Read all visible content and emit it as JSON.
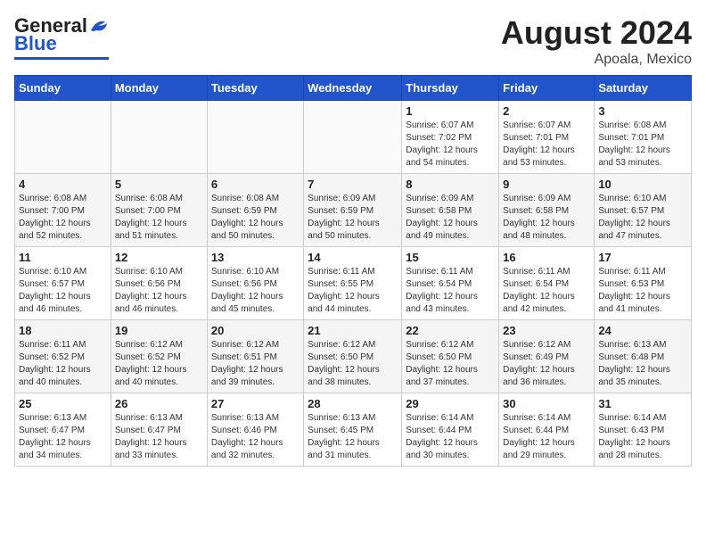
{
  "logo": {
    "general": "General",
    "blue": "Blue"
  },
  "title": "August 2024",
  "subtitle": "Apoala, Mexico",
  "weekdays": [
    "Sunday",
    "Monday",
    "Tuesday",
    "Wednesday",
    "Thursday",
    "Friday",
    "Saturday"
  ],
  "weeks": [
    [
      {
        "day": "",
        "detail": ""
      },
      {
        "day": "",
        "detail": ""
      },
      {
        "day": "",
        "detail": ""
      },
      {
        "day": "",
        "detail": ""
      },
      {
        "day": "1",
        "detail": "Sunrise: 6:07 AM\nSunset: 7:02 PM\nDaylight: 12 hours\nand 54 minutes."
      },
      {
        "day": "2",
        "detail": "Sunrise: 6:07 AM\nSunset: 7:01 PM\nDaylight: 12 hours\nand 53 minutes."
      },
      {
        "day": "3",
        "detail": "Sunrise: 6:08 AM\nSunset: 7:01 PM\nDaylight: 12 hours\nand 53 minutes."
      }
    ],
    [
      {
        "day": "4",
        "detail": "Sunrise: 6:08 AM\nSunset: 7:00 PM\nDaylight: 12 hours\nand 52 minutes."
      },
      {
        "day": "5",
        "detail": "Sunrise: 6:08 AM\nSunset: 7:00 PM\nDaylight: 12 hours\nand 51 minutes."
      },
      {
        "day": "6",
        "detail": "Sunrise: 6:08 AM\nSunset: 6:59 PM\nDaylight: 12 hours\nand 50 minutes."
      },
      {
        "day": "7",
        "detail": "Sunrise: 6:09 AM\nSunset: 6:59 PM\nDaylight: 12 hours\nand 50 minutes."
      },
      {
        "day": "8",
        "detail": "Sunrise: 6:09 AM\nSunset: 6:58 PM\nDaylight: 12 hours\nand 49 minutes."
      },
      {
        "day": "9",
        "detail": "Sunrise: 6:09 AM\nSunset: 6:58 PM\nDaylight: 12 hours\nand 48 minutes."
      },
      {
        "day": "10",
        "detail": "Sunrise: 6:10 AM\nSunset: 6:57 PM\nDaylight: 12 hours\nand 47 minutes."
      }
    ],
    [
      {
        "day": "11",
        "detail": "Sunrise: 6:10 AM\nSunset: 6:57 PM\nDaylight: 12 hours\nand 46 minutes."
      },
      {
        "day": "12",
        "detail": "Sunrise: 6:10 AM\nSunset: 6:56 PM\nDaylight: 12 hours\nand 46 minutes."
      },
      {
        "day": "13",
        "detail": "Sunrise: 6:10 AM\nSunset: 6:56 PM\nDaylight: 12 hours\nand 45 minutes."
      },
      {
        "day": "14",
        "detail": "Sunrise: 6:11 AM\nSunset: 6:55 PM\nDaylight: 12 hours\nand 44 minutes."
      },
      {
        "day": "15",
        "detail": "Sunrise: 6:11 AM\nSunset: 6:54 PM\nDaylight: 12 hours\nand 43 minutes."
      },
      {
        "day": "16",
        "detail": "Sunrise: 6:11 AM\nSunset: 6:54 PM\nDaylight: 12 hours\nand 42 minutes."
      },
      {
        "day": "17",
        "detail": "Sunrise: 6:11 AM\nSunset: 6:53 PM\nDaylight: 12 hours\nand 41 minutes."
      }
    ],
    [
      {
        "day": "18",
        "detail": "Sunrise: 6:11 AM\nSunset: 6:52 PM\nDaylight: 12 hours\nand 40 minutes."
      },
      {
        "day": "19",
        "detail": "Sunrise: 6:12 AM\nSunset: 6:52 PM\nDaylight: 12 hours\nand 40 minutes."
      },
      {
        "day": "20",
        "detail": "Sunrise: 6:12 AM\nSunset: 6:51 PM\nDaylight: 12 hours\nand 39 minutes."
      },
      {
        "day": "21",
        "detail": "Sunrise: 6:12 AM\nSunset: 6:50 PM\nDaylight: 12 hours\nand 38 minutes."
      },
      {
        "day": "22",
        "detail": "Sunrise: 6:12 AM\nSunset: 6:50 PM\nDaylight: 12 hours\nand 37 minutes."
      },
      {
        "day": "23",
        "detail": "Sunrise: 6:12 AM\nSunset: 6:49 PM\nDaylight: 12 hours\nand 36 minutes."
      },
      {
        "day": "24",
        "detail": "Sunrise: 6:13 AM\nSunset: 6:48 PM\nDaylight: 12 hours\nand 35 minutes."
      }
    ],
    [
      {
        "day": "25",
        "detail": "Sunrise: 6:13 AM\nSunset: 6:47 PM\nDaylight: 12 hours\nand 34 minutes."
      },
      {
        "day": "26",
        "detail": "Sunrise: 6:13 AM\nSunset: 6:47 PM\nDaylight: 12 hours\nand 33 minutes."
      },
      {
        "day": "27",
        "detail": "Sunrise: 6:13 AM\nSunset: 6:46 PM\nDaylight: 12 hours\nand 32 minutes."
      },
      {
        "day": "28",
        "detail": "Sunrise: 6:13 AM\nSunset: 6:45 PM\nDaylight: 12 hours\nand 31 minutes."
      },
      {
        "day": "29",
        "detail": "Sunrise: 6:14 AM\nSunset: 6:44 PM\nDaylight: 12 hours\nand 30 minutes."
      },
      {
        "day": "30",
        "detail": "Sunrise: 6:14 AM\nSunset: 6:44 PM\nDaylight: 12 hours\nand 29 minutes."
      },
      {
        "day": "31",
        "detail": "Sunrise: 6:14 AM\nSunset: 6:43 PM\nDaylight: 12 hours\nand 28 minutes."
      }
    ]
  ]
}
